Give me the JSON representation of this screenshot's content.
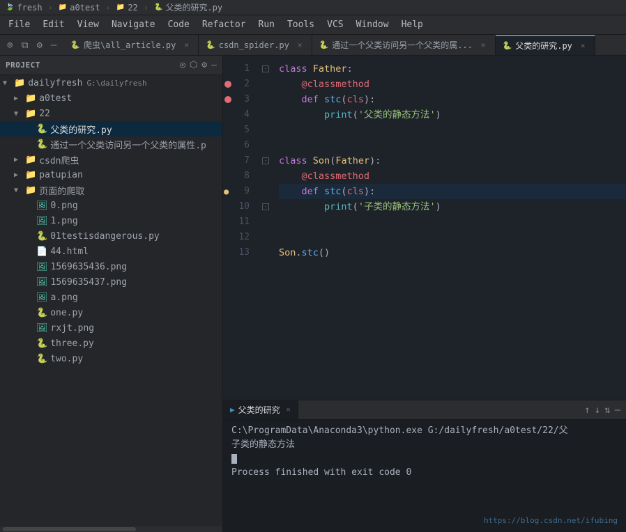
{
  "titlebar": {
    "items": [
      {
        "label": "fresh",
        "icon": "🍃"
      },
      {
        "sep": "›"
      },
      {
        "label": "a0test",
        "icon": "📁"
      },
      {
        "sep": "›"
      },
      {
        "label": "22",
        "icon": "📁"
      },
      {
        "sep": "›"
      },
      {
        "label": "父类的研究.py",
        "icon": "🐍"
      }
    ]
  },
  "menubar": {
    "items": [
      "File",
      "Edit",
      "View",
      "Navigate",
      "Code",
      "Refactor",
      "Run",
      "Tools",
      "VCS",
      "Window",
      "Help"
    ]
  },
  "tabs": [
    {
      "label": "爬虫\\all_article.py",
      "icon": "🐍",
      "active": false
    },
    {
      "label": "csdn_spider.py",
      "icon": "🐍",
      "active": false
    },
    {
      "label": "通过一个父类访问另一个父类的属...",
      "icon": "🐍",
      "active": false
    },
    {
      "label": "父类的研究.py",
      "icon": "🐍",
      "active": true
    }
  ],
  "sidebar": {
    "title": "Project",
    "tree": [
      {
        "level": 0,
        "name": "dailyfresh",
        "path": "G:\\dailyfresh",
        "type": "root",
        "expanded": true
      },
      {
        "level": 1,
        "name": "a0test",
        "type": "folder",
        "expanded": false
      },
      {
        "level": 1,
        "name": "22",
        "type": "folder",
        "expanded": true
      },
      {
        "level": 2,
        "name": "父类的研究.py",
        "type": "python",
        "selected": true
      },
      {
        "level": 2,
        "name": "通过一个父类访问另一个父类的属性.p",
        "type": "python"
      },
      {
        "level": 1,
        "name": "csdn爬虫",
        "type": "folder",
        "expanded": false
      },
      {
        "level": 1,
        "name": "patupian",
        "type": "folder",
        "expanded": false
      },
      {
        "level": 1,
        "name": "页面的爬取",
        "type": "folder",
        "expanded": true
      },
      {
        "level": 2,
        "name": "0.png",
        "type": "image"
      },
      {
        "level": 2,
        "name": "1.png",
        "type": "image"
      },
      {
        "level": 2,
        "name": "01testisdangerous.py",
        "type": "python"
      },
      {
        "level": 2,
        "name": "44.html",
        "type": "html"
      },
      {
        "level": 2,
        "name": "1569635436.png",
        "type": "image"
      },
      {
        "level": 2,
        "name": "1569635437.png",
        "type": "image"
      },
      {
        "level": 2,
        "name": "a.png",
        "type": "image"
      },
      {
        "level": 2,
        "name": "one.py",
        "type": "python"
      },
      {
        "level": 2,
        "name": "rxjt.png",
        "type": "image"
      },
      {
        "level": 2,
        "name": "three.py",
        "type": "python"
      },
      {
        "level": 2,
        "name": "two.py",
        "type": "python"
      }
    ]
  },
  "editor": {
    "filename": "父类的研究.py",
    "lines": [
      {
        "num": 1,
        "breakpoint": false,
        "debug": false,
        "fold": true,
        "tokens": [
          {
            "t": "kw",
            "v": "class "
          },
          {
            "t": "cls",
            "v": "Father"
          },
          {
            "t": "punc",
            "v": ":"
          }
        ]
      },
      {
        "num": 2,
        "breakpoint": true,
        "debug": false,
        "fold": false,
        "tokens": [
          {
            "t": "plain",
            "v": "    "
          },
          {
            "t": "dec",
            "v": "@classmethod"
          }
        ]
      },
      {
        "num": 3,
        "breakpoint": true,
        "debug": false,
        "fold": false,
        "tokens": [
          {
            "t": "plain",
            "v": "    "
          },
          {
            "t": "kw",
            "v": "def "
          },
          {
            "t": "fn",
            "v": "stc"
          },
          {
            "t": "punc",
            "v": "("
          },
          {
            "t": "param",
            "v": "cls"
          },
          {
            "t": "punc",
            "v": "):"
          }
        ]
      },
      {
        "num": 4,
        "breakpoint": false,
        "debug": false,
        "fold": false,
        "tokens": [
          {
            "t": "plain",
            "v": "        "
          },
          {
            "t": "kw2",
            "v": "print"
          },
          {
            "t": "punc",
            "v": "("
          },
          {
            "t": "str",
            "v": "'父类的静态方法'"
          },
          {
            "t": "punc",
            "v": ")"
          }
        ]
      },
      {
        "num": 5,
        "breakpoint": false,
        "debug": false,
        "fold": false,
        "tokens": []
      },
      {
        "num": 6,
        "breakpoint": false,
        "debug": false,
        "fold": false,
        "tokens": []
      },
      {
        "num": 7,
        "breakpoint": false,
        "debug": false,
        "fold": true,
        "tokens": [
          {
            "t": "kw",
            "v": "class "
          },
          {
            "t": "cls",
            "v": "Son"
          },
          {
            "t": "punc",
            "v": "("
          },
          {
            "t": "cls",
            "v": "Father"
          },
          {
            "t": "punc",
            "v": "):"
          }
        ]
      },
      {
        "num": 8,
        "breakpoint": false,
        "debug": false,
        "fold": false,
        "tokens": [
          {
            "t": "plain",
            "v": "    "
          },
          {
            "t": "dec",
            "v": "@classmethod"
          }
        ]
      },
      {
        "num": 9,
        "breakpoint": false,
        "debug": true,
        "fold": false,
        "tokens": [
          {
            "t": "plain",
            "v": "    "
          },
          {
            "t": "kw",
            "v": "def "
          },
          {
            "t": "fn",
            "v": "stc"
          },
          {
            "t": "punc",
            "v": "("
          },
          {
            "t": "param",
            "v": "cls"
          },
          {
            "t": "punc",
            "v": "):"
          }
        ]
      },
      {
        "num": 10,
        "breakpoint": false,
        "debug": false,
        "fold": false,
        "tokens": [
          {
            "t": "plain",
            "v": "        "
          },
          {
            "t": "kw2",
            "v": "print"
          },
          {
            "t": "punc",
            "v": "("
          },
          {
            "t": "str",
            "v": "'子类的静态方法'"
          },
          {
            "t": "punc",
            "v": ")"
          }
        ]
      },
      {
        "num": 11,
        "breakpoint": false,
        "debug": false,
        "fold": false,
        "tokens": []
      },
      {
        "num": 12,
        "breakpoint": false,
        "debug": false,
        "fold": false,
        "tokens": []
      },
      {
        "num": 13,
        "breakpoint": false,
        "debug": false,
        "fold": false,
        "tokens": [
          {
            "t": "cls",
            "v": "Son"
          },
          {
            "t": "punc",
            "v": "."
          },
          {
            "t": "fn",
            "v": "stc"
          },
          {
            "t": "punc",
            "v": "()"
          }
        ]
      }
    ]
  },
  "terminal": {
    "tab_label": "父类的研究",
    "cmd_line": "C:\\ProgramData\\Anaconda3\\python.exe G:/dailyfresh/a0test/22/父",
    "output1": "子类的静态方法",
    "output2": "Process finished with exit code 0",
    "watermark": "https://blog.csdn.net/ifubing"
  }
}
